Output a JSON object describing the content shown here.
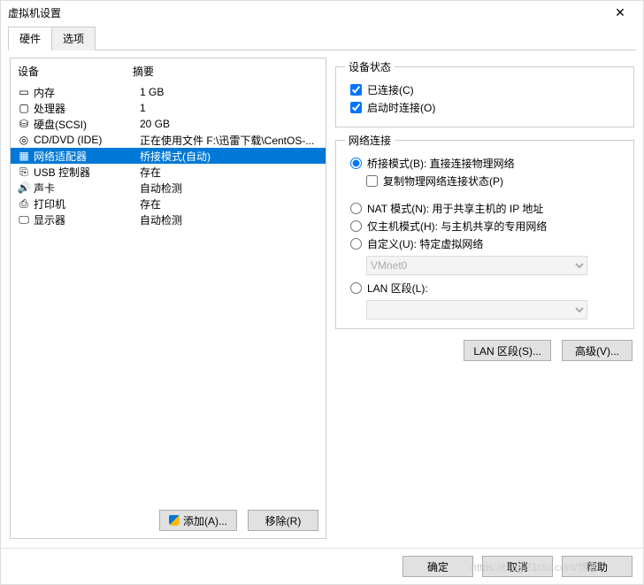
{
  "title": "虚拟机设置",
  "tabs": [
    "硬件",
    "选项"
  ],
  "columns": {
    "device": "设备",
    "summary": "摘要"
  },
  "devices": [
    {
      "icon": "memory-icon",
      "name": "内存",
      "summary": "1 GB",
      "selected": false
    },
    {
      "icon": "cpu-icon",
      "name": "处理器",
      "summary": "1",
      "selected": false
    },
    {
      "icon": "disk-icon",
      "name": "硬盘(SCSI)",
      "summary": "20 GB",
      "selected": false
    },
    {
      "icon": "cd-icon",
      "name": "CD/DVD (IDE)",
      "summary": "正在使用文件 F:\\迅雷下载\\CentOS-...",
      "selected": false
    },
    {
      "icon": "nic-icon",
      "name": "网络适配器",
      "summary": "桥接模式(自动)",
      "selected": true
    },
    {
      "icon": "usb-icon",
      "name": "USB 控制器",
      "summary": "存在",
      "selected": false
    },
    {
      "icon": "sound-icon",
      "name": "声卡",
      "summary": "自动检测",
      "selected": false
    },
    {
      "icon": "printer-icon",
      "name": "打印机",
      "summary": "存在",
      "selected": false
    },
    {
      "icon": "display-icon",
      "name": "显示器",
      "summary": "自动检测",
      "selected": false
    }
  ],
  "right": {
    "status": {
      "legend": "设备状态",
      "connected": "已连接(C)",
      "connect_poweron": "启动时连接(O)"
    },
    "net": {
      "legend": "网络连接",
      "bridged": "桥接模式(B): 直接连接物理网络",
      "replicate": "复制物理网络连接状态(P)",
      "nat": "NAT 模式(N): 用于共享主机的 IP 地址",
      "hostonly": "仅主机模式(H): 与主机共享的专用网络",
      "custom": "自定义(U): 特定虚拟网络",
      "custom_value": "VMnet0",
      "lan_segment": "LAN 区段(L):"
    }
  },
  "buttons": {
    "add": "添加(A)...",
    "remove": "移除(R)",
    "lan_segments": "LAN 区段(S)...",
    "advanced": "高级(V)...",
    "ok": "确定",
    "cancel": "取消",
    "help": "帮助"
  },
  "watermark": "https://blog.51cto.com/博客",
  "icons": {
    "memory-icon": "▭",
    "cpu-icon": "▢",
    "disk-icon": "⛁",
    "cd-icon": "◎",
    "nic-icon": "▦",
    "usb-icon": "⎘",
    "sound-icon": "🔊",
    "printer-icon": "⎙",
    "display-icon": "🖵"
  }
}
